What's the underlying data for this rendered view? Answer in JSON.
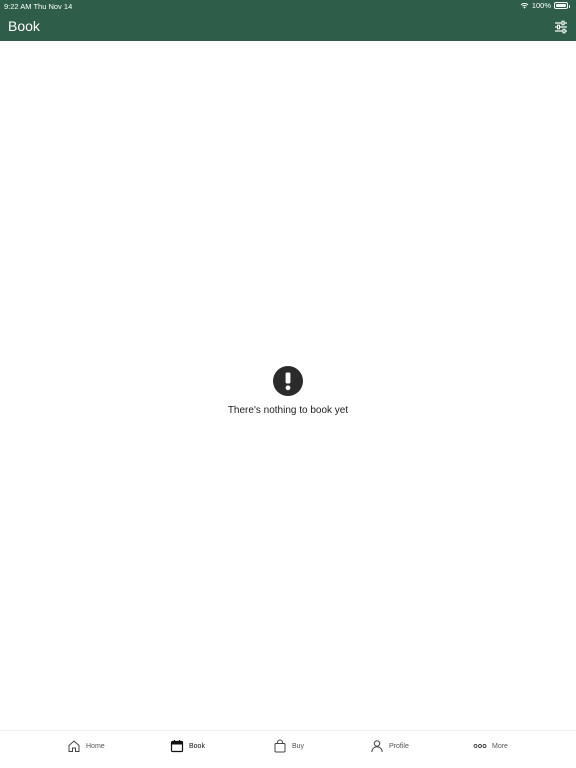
{
  "status": {
    "time": "9:22 AM Thu Nov 14",
    "battery": "100%",
    "battery_level": 1.0
  },
  "header": {
    "title": "Book",
    "filter_icon": "sliders-icon"
  },
  "empty": {
    "message": "There's nothing to book yet",
    "icon": "exclamation-circle-icon"
  },
  "tabs": [
    {
      "label": "Home",
      "icon": "home-icon"
    },
    {
      "label": "Book",
      "icon": "calendar-icon",
      "active": true
    },
    {
      "label": "Buy",
      "icon": "shopping-bag-icon"
    },
    {
      "label": "Profile",
      "icon": "person-icon"
    },
    {
      "label": "More",
      "icon": "more-dots-icon"
    }
  ],
  "colors": {
    "header": "#2e5e4a",
    "text": "#222222"
  }
}
